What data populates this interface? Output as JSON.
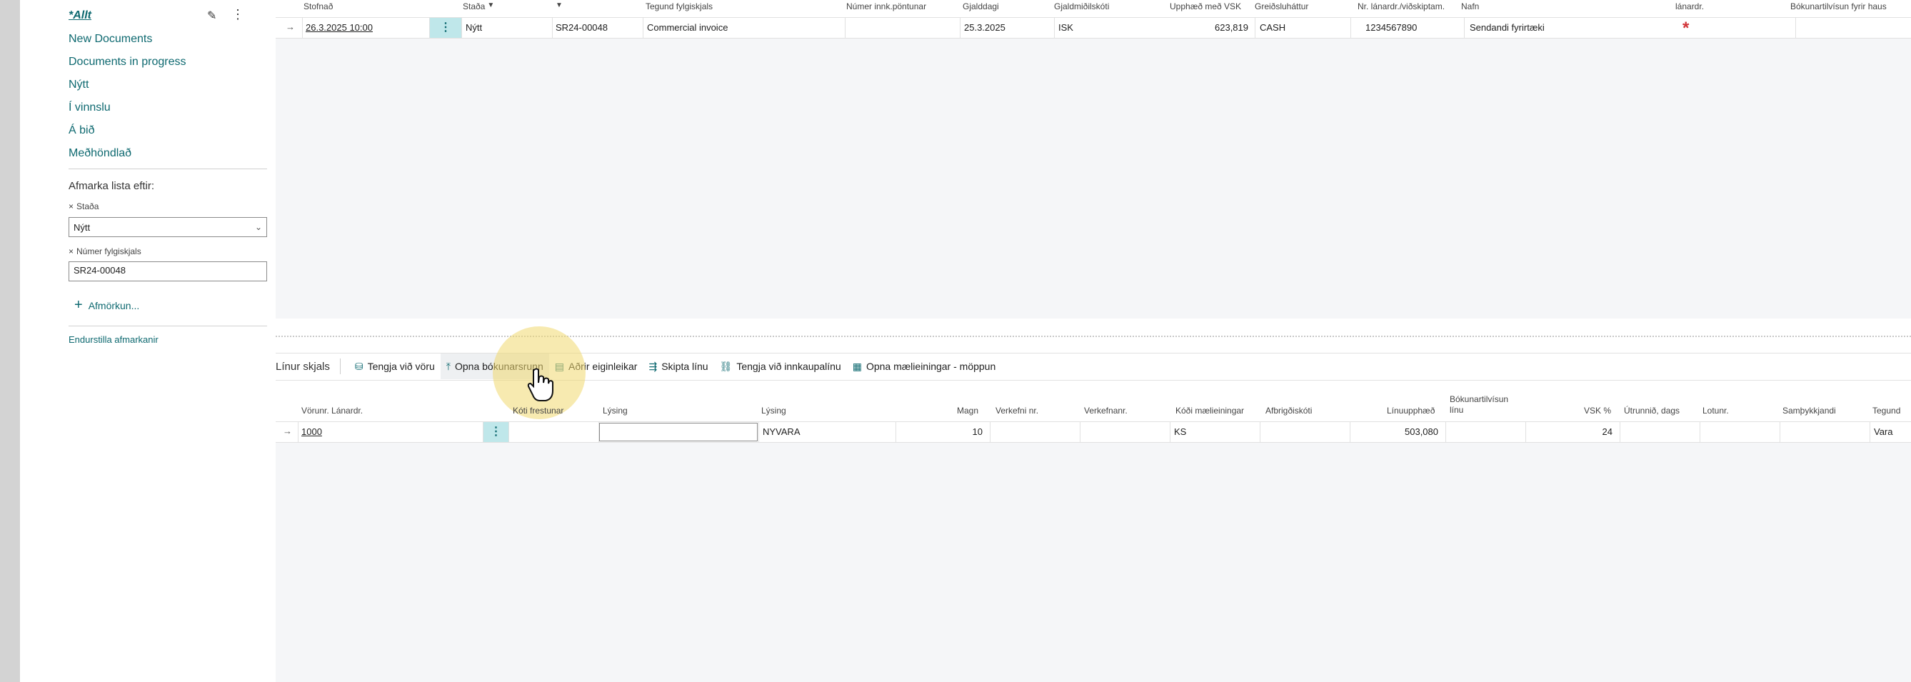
{
  "sidebar": {
    "views": [
      {
        "label": "*Allt",
        "active": true
      },
      {
        "label": "New Documents"
      },
      {
        "label": "Documents in progress"
      },
      {
        "label": "Nýtt"
      },
      {
        "label": "Í vinnslu"
      },
      {
        "label": "Á bið"
      },
      {
        "label": "Meðhöndlað"
      }
    ],
    "filter_heading": "Afmarka lista eftir:",
    "filters": [
      {
        "label": "Staða",
        "value": "Nýtt",
        "type": "select"
      },
      {
        "label": "Númer fylgiskjals",
        "value": "SR24-00048",
        "type": "text"
      }
    ],
    "add_filter": "Afmörkun...",
    "reset_filters": "Endurstilla afmarkanir"
  },
  "upper_grid": {
    "headers": [
      "Stofnað",
      "Staða",
      "",
      "Tegund fylgiskjals",
      "Númer innk.pöntunar",
      "Gjalddagi",
      "Gjaldmiðilskóti",
      "Upphæð með VSK",
      "Greiðsluháttur",
      "Nr. lánardr./viðskiptam.",
      "Nafn",
      "lánardr.",
      "Bókunartilvísun fyrir haus"
    ],
    "row": {
      "created": "26.3.2025 10:00",
      "status": "Nýtt",
      "doc_no": "SR24-00048",
      "doc_type": "Commercial invoice",
      "po_no": "",
      "due_date": "25.3.2025",
      "currency": "ISK",
      "amount_vat": "623,819",
      "payment_method": "CASH",
      "vendor_no": "1234567890",
      "name": "Sendandi fyrirtæki",
      "vendor_flag": "*"
    }
  },
  "lines": {
    "title": "Línur skjals",
    "actions": [
      {
        "label": "Tengja við vöru",
        "icon": "link-item-icon"
      },
      {
        "label": "Opna bókunarsrunn",
        "icon": "open-posting-icon"
      },
      {
        "label": "Aðrir eiginleikar",
        "icon": "properties-icon"
      },
      {
        "label": "Skipta línu",
        "icon": "split-line-icon"
      },
      {
        "label": "Tengja við innkaupalínu",
        "icon": "link-purchase-line-icon"
      },
      {
        "label": "Opna mælieiningar - möppun",
        "icon": "uom-mapping-icon"
      }
    ],
    "headers": [
      "Vörunr. Lánardr.",
      "Kóti frestunar",
      "Lýsing",
      "Lýsing",
      "Magn",
      "Verkefni nr.",
      "Verkefnanr.",
      "Kóði mælieiningar",
      "Afbrigðiskóti",
      "Línuupphæð",
      "Bókunartilvísun línu",
      "VSK %",
      "Útrunnið, dags",
      "Lotunr.",
      "Samþykkjandi",
      "Tegund"
    ],
    "row": {
      "item_no": "1000",
      "deferral": "",
      "description_input": "",
      "description": "NYVARA",
      "qty": "10",
      "job_no": "",
      "task_no": "",
      "uom": "KS",
      "variant": "",
      "line_amount": "503,080",
      "posting_ref": "",
      "vat_pct": "24",
      "expiry": "",
      "lot": "",
      "approver": "",
      "type": "Vara"
    }
  },
  "colors": {
    "accent": "#0e6970",
    "required": "#d13438",
    "highlight": "#f0d870"
  }
}
